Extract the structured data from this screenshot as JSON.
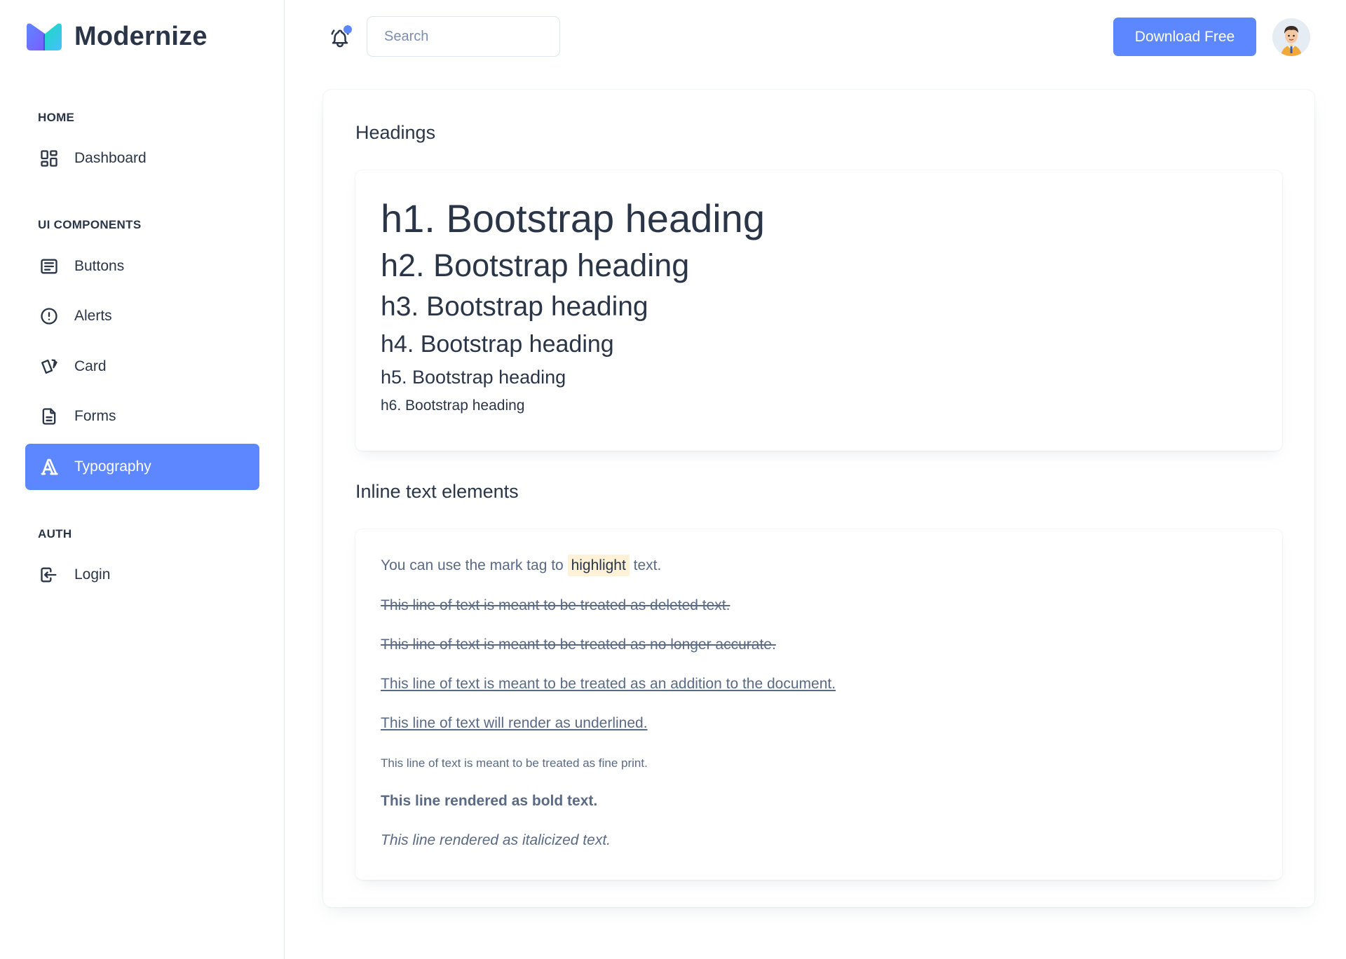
{
  "brand": {
    "name": "Modernize"
  },
  "sidebar": {
    "sections": [
      {
        "caption": "HOME",
        "items": [
          {
            "label": "Dashboard",
            "icon": "layout-dashboard-icon"
          }
        ]
      },
      {
        "caption": "UI COMPONENTS",
        "items": [
          {
            "label": "Buttons",
            "icon": "article-icon"
          },
          {
            "label": "Alerts",
            "icon": "alert-circle-icon"
          },
          {
            "label": "Card",
            "icon": "cards-icon"
          },
          {
            "label": "Forms",
            "icon": "file-description-icon"
          },
          {
            "label": "Typography",
            "icon": "typography-icon",
            "active": true
          }
        ]
      },
      {
        "caption": "AUTH",
        "items": [
          {
            "label": "Login",
            "icon": "login-icon"
          }
        ]
      }
    ]
  },
  "header": {
    "search_placeholder": "Search",
    "download_label": "Download Free",
    "notification_dot": true
  },
  "headings_section": {
    "title": "Headings",
    "h1": "h1. Bootstrap heading",
    "h2": "h2. Bootstrap heading",
    "h3": "h3. Bootstrap heading",
    "h4": "h4. Bootstrap heading",
    "h5": "h5. Bootstrap heading",
    "h6": "h6. Bootstrap heading"
  },
  "inline_section": {
    "title": "Inline text elements",
    "mark_prefix": "You can use the mark tag to",
    "mark_word": "highlight",
    "mark_suffix": "text.",
    "deleted": "This line of text is meant to be treated as deleted text.",
    "strikethrough": "This line of text is meant to be treated as no longer accurate.",
    "inserted": "This line of text is meant to be treated as an addition to the document.",
    "underlined": "This line of text will render as underlined.",
    "fine_print": "This line of text is meant to be treated as fine print.",
    "bold": "This line rendered as bold text.",
    "italic": "This line rendered as italicized text."
  },
  "colors": {
    "primary": "#5d87ff",
    "text_dark": "#2a3547",
    "text_muted": "#5a6a85",
    "mark_bg": "#fdf1d7"
  }
}
